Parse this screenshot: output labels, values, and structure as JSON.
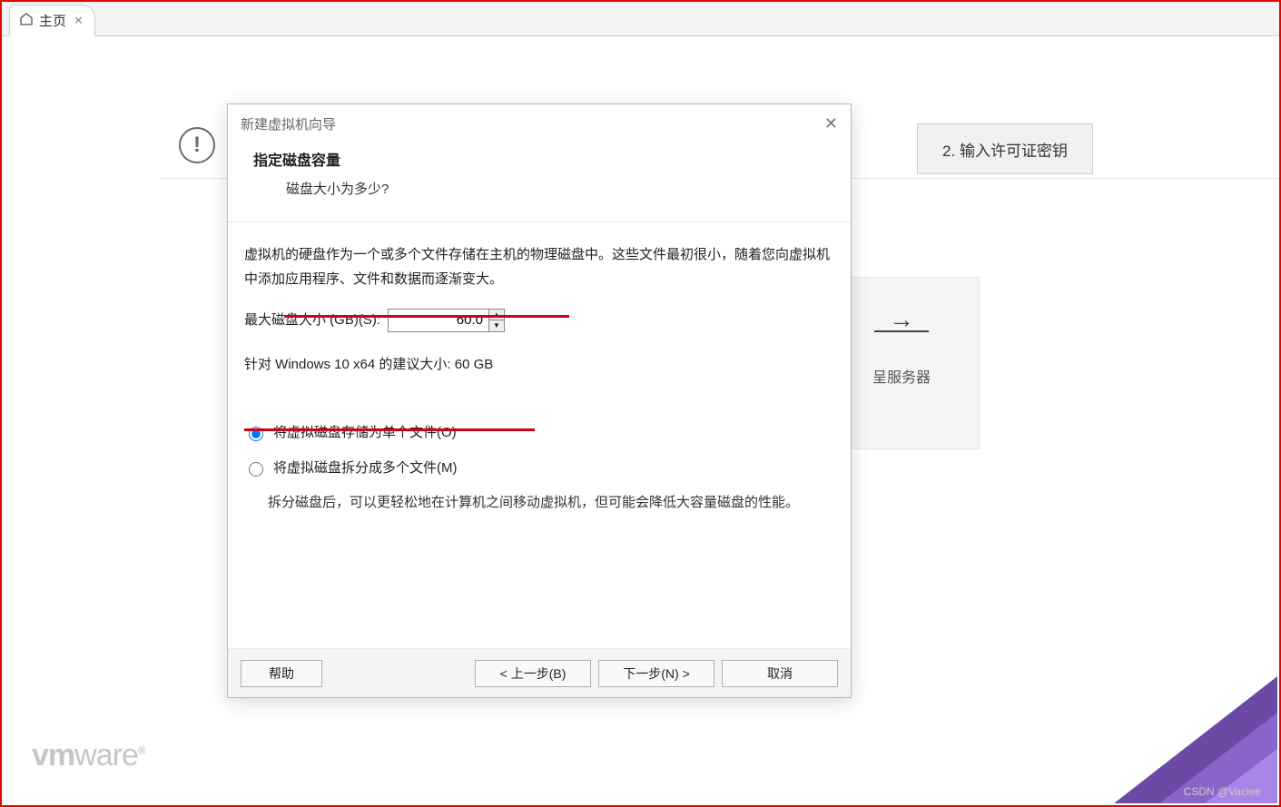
{
  "tab": {
    "label": "主页"
  },
  "background": {
    "card_label": "呈服务器",
    "button_label": "2. 输入许可证密钥"
  },
  "logo": {
    "bold": "vm",
    "thin": "ware"
  },
  "watermark": "CSDN @Vaclee",
  "dialog": {
    "title": "新建虚拟机向导",
    "heading": "指定磁盘容量",
    "subheading": "磁盘大小为多少?",
    "para": "虚拟机的硬盘作为一个或多个文件存储在主机的物理磁盘中。这些文件最初很小，随着您向虚拟机中添加应用程序、文件和数据而逐渐变大。",
    "input_label": "最大磁盘大小 (GB)(S):",
    "input_value": "60.0",
    "recommend": "针对 Windows 10 x64 的建议大小: 60 GB",
    "radio1": "将虚拟磁盘存储为单个文件(O)",
    "radio2": "将虚拟磁盘拆分成多个文件(M)",
    "radio2_desc": "拆分磁盘后，可以更轻松地在计算机之间移动虚拟机，但可能会降低大容量磁盘的性能。",
    "buttons": {
      "help": "帮助",
      "back": "< 上一步(B)",
      "next": "下一步(N) >",
      "cancel": "取消"
    }
  }
}
